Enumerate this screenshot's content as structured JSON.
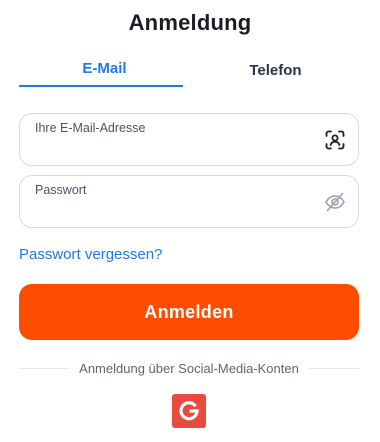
{
  "page": {
    "title": "Anmeldung"
  },
  "tabs": [
    {
      "label": "E-Mail",
      "active": true
    },
    {
      "label": "Telefon",
      "active": false
    }
  ],
  "email": {
    "label": "Ihre E-Mail-Adresse",
    "value": "",
    "placeholder": "",
    "icon": "face-scan-icon"
  },
  "password": {
    "label": "Passwort",
    "value": "",
    "placeholder": "",
    "icon": "eye-off-icon"
  },
  "forgot_link": "Passwort vergessen?",
  "login_button": "Anmelden",
  "social": {
    "divider_text": "Anmeldung über Social-Media-Konten",
    "providers": [
      {
        "icon": "google-icon",
        "color": "#e94b3c"
      }
    ]
  },
  "colors": {
    "accent": "#1f7ae0",
    "primary_button": "#ff4d00",
    "google": "#e94b3c"
  }
}
